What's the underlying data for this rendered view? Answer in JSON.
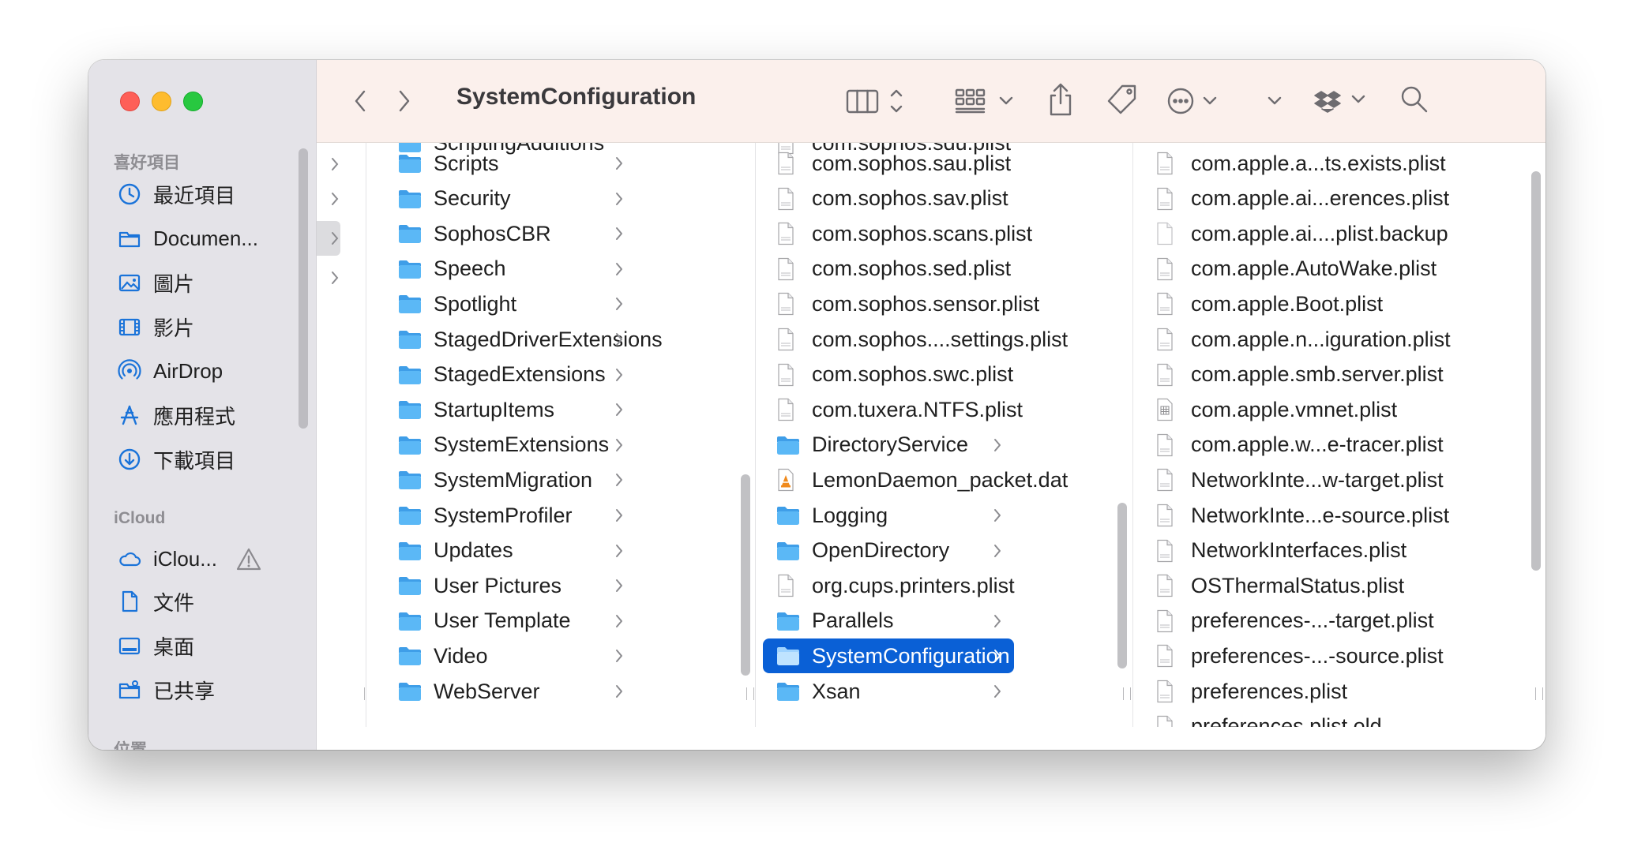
{
  "window_title": "SystemConfiguration",
  "sidebar": {
    "favorites_header": "喜好項目",
    "favorites": [
      {
        "label": "最近項目",
        "icon": "clock-icon"
      },
      {
        "label": "Documen...",
        "icon": "folder-icon"
      },
      {
        "label": "圖片",
        "icon": "photo-icon"
      },
      {
        "label": "影片",
        "icon": "film-icon"
      },
      {
        "label": "AirDrop",
        "icon": "airdrop-icon"
      },
      {
        "label": "應用程式",
        "icon": "applications-icon"
      },
      {
        "label": "下載項目",
        "icon": "download-icon"
      }
    ],
    "icloud_header": "iCloud",
    "icloud": [
      {
        "label": "iClou...",
        "icon": "cloud-icon"
      },
      {
        "label": "文件",
        "icon": "document-icon"
      },
      {
        "label": "桌面",
        "icon": "desktop-icon"
      },
      {
        "label": "已共享",
        "icon": "shared-folder-icon"
      }
    ],
    "locations_header": "位置"
  },
  "toolbar": {
    "back": "chevron-left-icon",
    "forward": "chevron-right-icon",
    "view": "column-view-icon",
    "group": "grid-group-icon",
    "share": "share-icon",
    "tag": "tag-icon",
    "more": "ellipsis-circle-icon",
    "dropdown": "chevron-down-icon",
    "dropbox": "dropbox-icon",
    "search": "search-icon"
  },
  "columns": {
    "col1": {
      "partial_top": "ScriptingAdditions",
      "items": [
        "Scripts",
        "Security",
        "SophosCBR",
        "Speech",
        "Spotlight",
        "StagedDriverExtensions",
        "StagedExtensions",
        "StartupItems",
        "SystemExtensions",
        "SystemMigration",
        "SystemProfiler",
        "Updates",
        "User Pictures",
        "User Template",
        "Video",
        "WebServer"
      ]
    },
    "col2": {
      "partial_top": "com.sophos.sdu.plist",
      "items": [
        {
          "name": "com.sophos.sau.plist",
          "type": "plist"
        },
        {
          "name": "com.sophos.sav.plist",
          "type": "plist"
        },
        {
          "name": "com.sophos.scans.plist",
          "type": "plist"
        },
        {
          "name": "com.sophos.sed.plist",
          "type": "plist"
        },
        {
          "name": "com.sophos.sensor.plist",
          "type": "plist"
        },
        {
          "name": "com.sophos....settings.plist",
          "type": "plist"
        },
        {
          "name": "com.sophos.swc.plist",
          "type": "plist"
        },
        {
          "name": "com.tuxera.NTFS.plist",
          "type": "plist"
        },
        {
          "name": "DirectoryService",
          "type": "folder"
        },
        {
          "name": "LemonDaemon_packet.dat",
          "type": "vlc"
        },
        {
          "name": "Logging",
          "type": "folder"
        },
        {
          "name": "OpenDirectory",
          "type": "folder"
        },
        {
          "name": "org.cups.printers.plist",
          "type": "plist"
        },
        {
          "name": "Parallels",
          "type": "folder"
        },
        {
          "name": "SystemConfiguration",
          "type": "folder",
          "selected": true
        },
        {
          "name": "Xsan",
          "type": "folder"
        }
      ]
    },
    "col3": {
      "items": [
        {
          "name": "com.apple.a...ts.exists.plist",
          "type": "plist"
        },
        {
          "name": "com.apple.ai...erences.plist",
          "type": "plist"
        },
        {
          "name": "com.apple.ai....plist.backup",
          "type": "blank"
        },
        {
          "name": "com.apple.AutoWake.plist",
          "type": "plist"
        },
        {
          "name": "com.apple.Boot.plist",
          "type": "plist"
        },
        {
          "name": "com.apple.n...iguration.plist",
          "type": "plist"
        },
        {
          "name": "com.apple.smb.server.plist",
          "type": "plist"
        },
        {
          "name": "com.apple.vmnet.plist",
          "type": "grid"
        },
        {
          "name": "com.apple.w...e-tracer.plist",
          "type": "plist"
        },
        {
          "name": "NetworkInte...w-target.plist",
          "type": "plist"
        },
        {
          "name": "NetworkInte...e-source.plist",
          "type": "plist"
        },
        {
          "name": "NetworkInterfaces.plist",
          "type": "plist"
        },
        {
          "name": "OSThermalStatus.plist",
          "type": "plist"
        },
        {
          "name": "preferences-...-target.plist",
          "type": "plist"
        },
        {
          "name": "preferences-...-source.plist",
          "type": "plist"
        },
        {
          "name": "preferences.plist",
          "type": "plist"
        }
      ],
      "partial_bottom": "preferences.plist.old"
    }
  },
  "colors": {
    "selection": "#0a60d6",
    "folder": "#53b5f5",
    "sidebar_icon": "#1a73d9"
  }
}
